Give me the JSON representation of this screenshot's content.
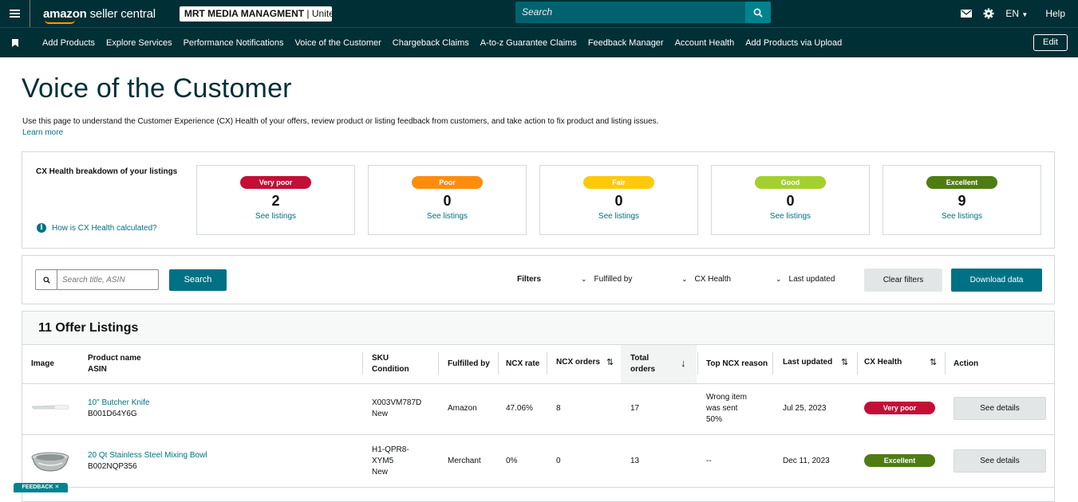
{
  "topbar": {
    "brand_bold": "amazon",
    "brand_light": " seller central",
    "account_name": "MRT MEDIA MANAGMENT",
    "account_region": " | Unite...",
    "search_placeholder": "Search",
    "language": "EN",
    "help": "Help"
  },
  "nav": {
    "items": [
      "Add Products",
      "Explore Services",
      "Performance Notifications",
      "Voice of the Customer",
      "Chargeback Claims",
      "A-to-z Guarantee Claims",
      "Feedback Manager",
      "Account Health",
      "Add Products via Upload"
    ],
    "edit": "Edit"
  },
  "page": {
    "title": "Voice of the Customer",
    "description": "Use this page to understand the Customer Experience (CX) Health of your offers, review product or listing feedback from customers, and take action to fix product and listing issues.",
    "learn_more": "Learn more"
  },
  "cx_health": {
    "label": "CX Health breakdown of your listings",
    "info_link": "How is CX Health calculated?",
    "tiles": [
      {
        "label": "Very poor",
        "count": "2",
        "link": "See listings",
        "color": "#c40e36",
        "text_color": "#ffffff"
      },
      {
        "label": "Poor",
        "count": "0",
        "link": "See listings",
        "color": "#ff8c0f",
        "text_color": "#ffffff"
      },
      {
        "label": "Fair",
        "count": "0",
        "link": "See listings",
        "color": "#ffc90b",
        "text_color": "#ffffff"
      },
      {
        "label": "Good",
        "count": "0",
        "link": "See listings",
        "color": "#a4d02f",
        "text_color": "#ffffff"
      },
      {
        "label": "Excellent",
        "count": "9",
        "link": "See listings",
        "color": "#4f7c12",
        "text_color": "#ffffff"
      }
    ]
  },
  "filters": {
    "search_placeholder": "Search title, ASIN",
    "search_button": "Search",
    "filters_label": "Filters",
    "dropdowns": [
      "Fulfilled by",
      "CX Health",
      "Last updated"
    ],
    "clear": "Clear filters",
    "download": "Download data"
  },
  "table": {
    "title": "11 Offer Listings",
    "columns": {
      "image": "Image",
      "product_name": "Product name",
      "asin": "ASIN",
      "sku": "SKU",
      "condition": "Condition",
      "fulfilled_by": "Fulfilled by",
      "ncx_rate": "NCX rate",
      "ncx_orders": "NCX orders",
      "total_orders_1": "Total",
      "total_orders_2": "orders",
      "top_ncx_reason": "Top NCX reason",
      "last_updated": "Last updated",
      "cx_health": "CX Health",
      "action": "Action"
    },
    "rows": [
      {
        "product_name": "10\" Butcher Knife",
        "asin": "B001D64Y6G",
        "sku_1": "X003VM787D",
        "sku_2": "",
        "condition": "New",
        "fulfilled_by": "Amazon",
        "ncx_rate": "47.06%",
        "ncx_orders": "8",
        "total_orders": "17",
        "reason_1": "Wrong item",
        "reason_2": "was sent",
        "reason_3": "50%",
        "last_updated": "Jul 25, 2023",
        "cx_health": "Very poor",
        "cx_color": "#c40e36",
        "action": "See details"
      },
      {
        "product_name": "20 Qt Stainless Steel Mixing Bowl",
        "asin": "B002NQP356",
        "sku_1": "H1-QPR8-",
        "sku_2": "XYM5",
        "condition": "New",
        "fulfilled_by": "Merchant",
        "ncx_rate": "0%",
        "ncx_orders": "0",
        "total_orders": "13",
        "reason_1": "--",
        "reason_2": "",
        "reason_3": "",
        "last_updated": "Dec 11, 2023",
        "cx_health": "Excellent",
        "cx_color": "#4f7c12",
        "action": "See details"
      }
    ]
  },
  "feedback_tab": "FEEDBACK ✕"
}
